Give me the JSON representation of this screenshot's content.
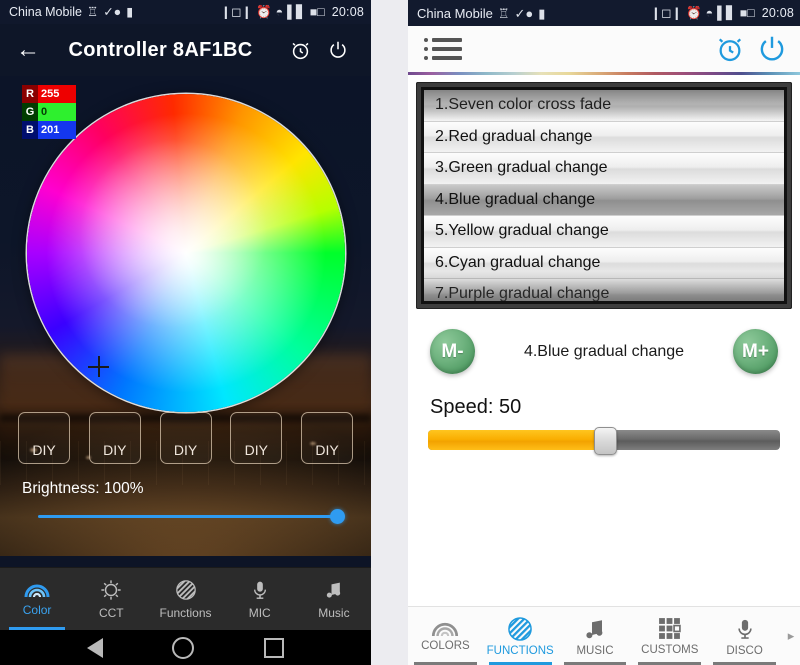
{
  "left_phone": {
    "status_bar": {
      "carrier": "China Mobile",
      "time": "20:08",
      "icons": [
        "crown-icon",
        "check-circle-icon",
        "battery-small-icon",
        "vibrate-icon",
        "alarm-icon",
        "wifi-icon",
        "signal-4g-icon",
        "battery-icon"
      ]
    },
    "app_bar": {
      "back_icon": "back-arrow-icon",
      "title": "Controller 8AF1BC",
      "alarm_icon": "alarm-clock-icon",
      "power_icon": "power-icon"
    },
    "color_values": {
      "r_key": "R",
      "r_value": "255",
      "g_key": "G",
      "g_value": "0",
      "b_key": "B",
      "b_value": "201"
    },
    "diy_buttons": [
      "DIY",
      "DIY",
      "DIY",
      "DIY",
      "DIY"
    ],
    "brightness": {
      "label": "Brightness: 100%",
      "percent": 100
    },
    "tabs": [
      {
        "label": "Color",
        "icon": "rainbow-icon",
        "active": true
      },
      {
        "label": "CCT",
        "icon": "sun-gear-icon",
        "active": false
      },
      {
        "label": "Functions",
        "icon": "striped-circle-icon",
        "active": false
      },
      {
        "label": "MIC",
        "icon": "microphone-icon",
        "active": false
      },
      {
        "label": "Music",
        "icon": "music-note-icon",
        "active": false
      }
    ],
    "nav_bar": [
      "back-triangle-icon",
      "home-circle-icon",
      "recents-square-icon"
    ]
  },
  "right_phone": {
    "status_bar": {
      "carrier": "China Mobile",
      "time": "20:08"
    },
    "app_bar": {
      "menu_icon": "list-menu-icon",
      "alarm_icon": "alarm-clock-icon",
      "power_icon": "power-icon"
    },
    "function_list": [
      {
        "text": "1.Seven color cross fade",
        "selected": false
      },
      {
        "text": "2.Red gradual change",
        "selected": false
      },
      {
        "text": "3.Green gradual change",
        "selected": false
      },
      {
        "text": "4.Blue gradual change",
        "selected": true
      },
      {
        "text": "5.Yellow gradual change",
        "selected": false
      },
      {
        "text": "6.Cyan gradual change",
        "selected": false
      },
      {
        "text": "7.Purple gradual change",
        "selected": false
      }
    ],
    "mode_controls": {
      "prev_label": "M-",
      "current_mode": "4.Blue gradual change",
      "next_label": "M+"
    },
    "speed": {
      "label": "Speed: 50",
      "value": 50
    },
    "tabs": [
      {
        "label": "COLORS",
        "icon": "rainbow-icon",
        "active": false
      },
      {
        "label": "FUNCTIONS",
        "icon": "striped-circle-icon",
        "active": true
      },
      {
        "label": "MUSIC",
        "icon": "music-note-icon",
        "active": false
      },
      {
        "label": "CUSTOMS",
        "icon": "grid-squares-icon",
        "active": false
      },
      {
        "label": "DISCO",
        "icon": "microphone-icon",
        "active": false
      }
    ],
    "tab_scroll_arrow": "▸"
  },
  "colors": {
    "accent_blue": "#2f9bf0",
    "accent_cyan": "#1f9ade",
    "green_button": "#5aa26d",
    "slider_yellow": "#f9ad00",
    "dark_header": "#0e1628"
  }
}
